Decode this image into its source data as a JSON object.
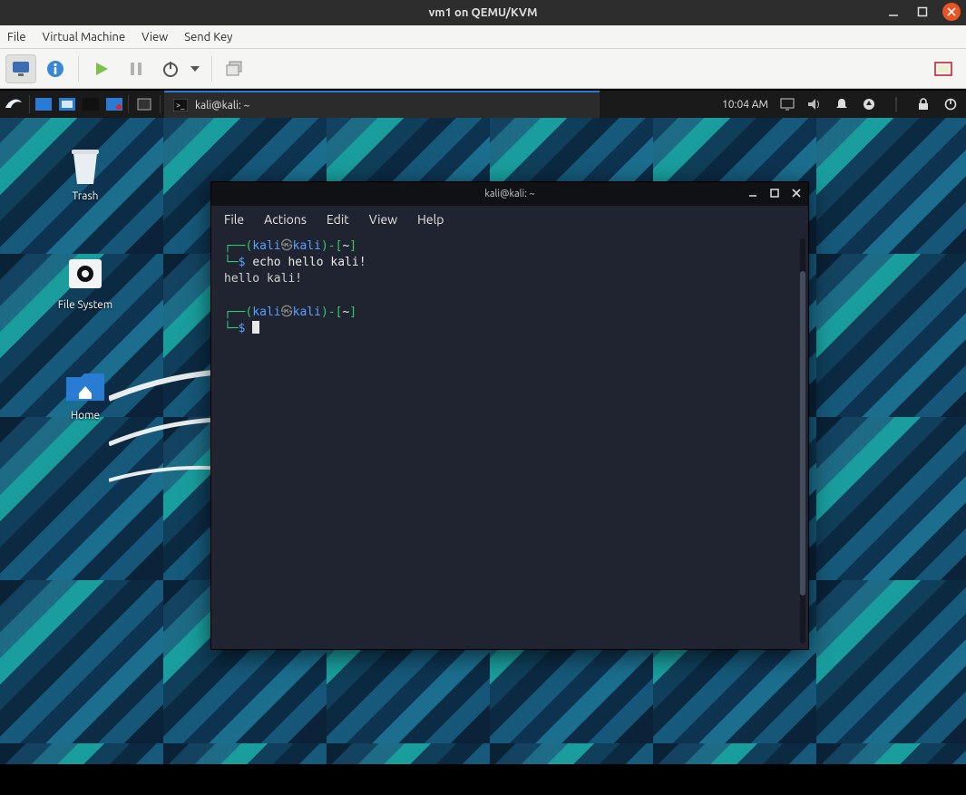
{
  "host": {
    "title": "vm1 on QEMU/KVM",
    "menu": {
      "file": "File",
      "vm": "Virtual Machine",
      "view": "View",
      "sendkey": "Send Key"
    }
  },
  "kali_panel": {
    "task_title": "kali@kali: ~",
    "clock": "10:04 AM"
  },
  "desktop": {
    "trash": "Trash",
    "filesystem": "File System",
    "home": "Home"
  },
  "terminal": {
    "title": "kali@kali: ~",
    "menu": {
      "file": "File",
      "actions": "Actions",
      "edit": "Edit",
      "view": "View",
      "help": "Help"
    },
    "prompt": {
      "open": "┌──(",
      "user": "kali",
      "sep": "㉿",
      "host": "kali",
      "close": ")",
      "dash": "-",
      "lbrack": "[",
      "cwd": "~",
      "rbrack": "]",
      "line2_prefix": "└─",
      "dollar": "$"
    },
    "cmd1": "echo hello kali!",
    "out1": "hello kali!"
  }
}
